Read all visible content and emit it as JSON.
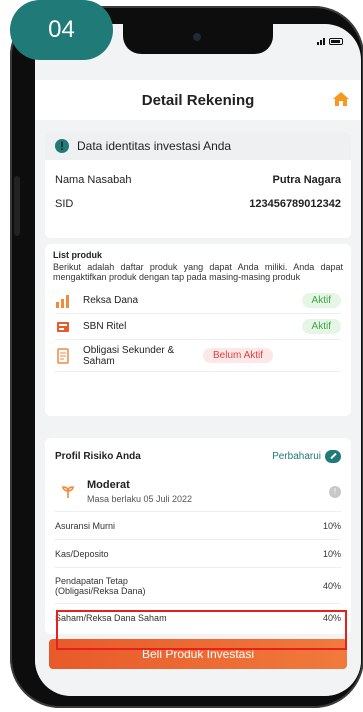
{
  "step_badge": "04",
  "header": {
    "title": "Detail Rekening"
  },
  "identity": {
    "heading": "Data identitas investasi Anda",
    "rows": [
      {
        "label": "Nama Nasabah",
        "value": "Putra Nagara"
      },
      {
        "label": "SID",
        "value": "123456789012342"
      }
    ]
  },
  "products": {
    "title": "List produk",
    "description": "Berikut adalah daftar produk yang dapat Anda miliki. Anda dapat mengaktifkan produk dengan tap pada masing-masing produk",
    "items": [
      {
        "name": "Reksa Dana",
        "status": "Aktif",
        "icon": "bar-chart-icon"
      },
      {
        "name": "SBN Ritel",
        "status": "Aktif",
        "icon": "bond-icon"
      },
      {
        "name": "Obligasi Sekunder & Saham",
        "status": "Belum Aktif",
        "icon": "document-icon"
      }
    ]
  },
  "risk": {
    "title": "Profil Risiko Anda",
    "update_label": "Perbaharui",
    "profile_name": "Moderat",
    "validity": "Masa berlaku 05 Juli 2022",
    "allocations": [
      {
        "label": "Asuransi Murni",
        "value": "10%"
      },
      {
        "label": "Kas/Deposito",
        "value": "10%"
      },
      {
        "label": "Pendapatan Tetap\n(Obligasi/Reksa Dana)",
        "value": "40%"
      },
      {
        "label": "Saham/Reksa Dana Saham",
        "value": "40%"
      }
    ]
  },
  "cta": {
    "label": "Beli Produk Investasi"
  },
  "colors": {
    "accent": "#1f7a78",
    "cta": "#ec6a33",
    "highlight": "#e6201a",
    "home": "#f59a1e"
  }
}
